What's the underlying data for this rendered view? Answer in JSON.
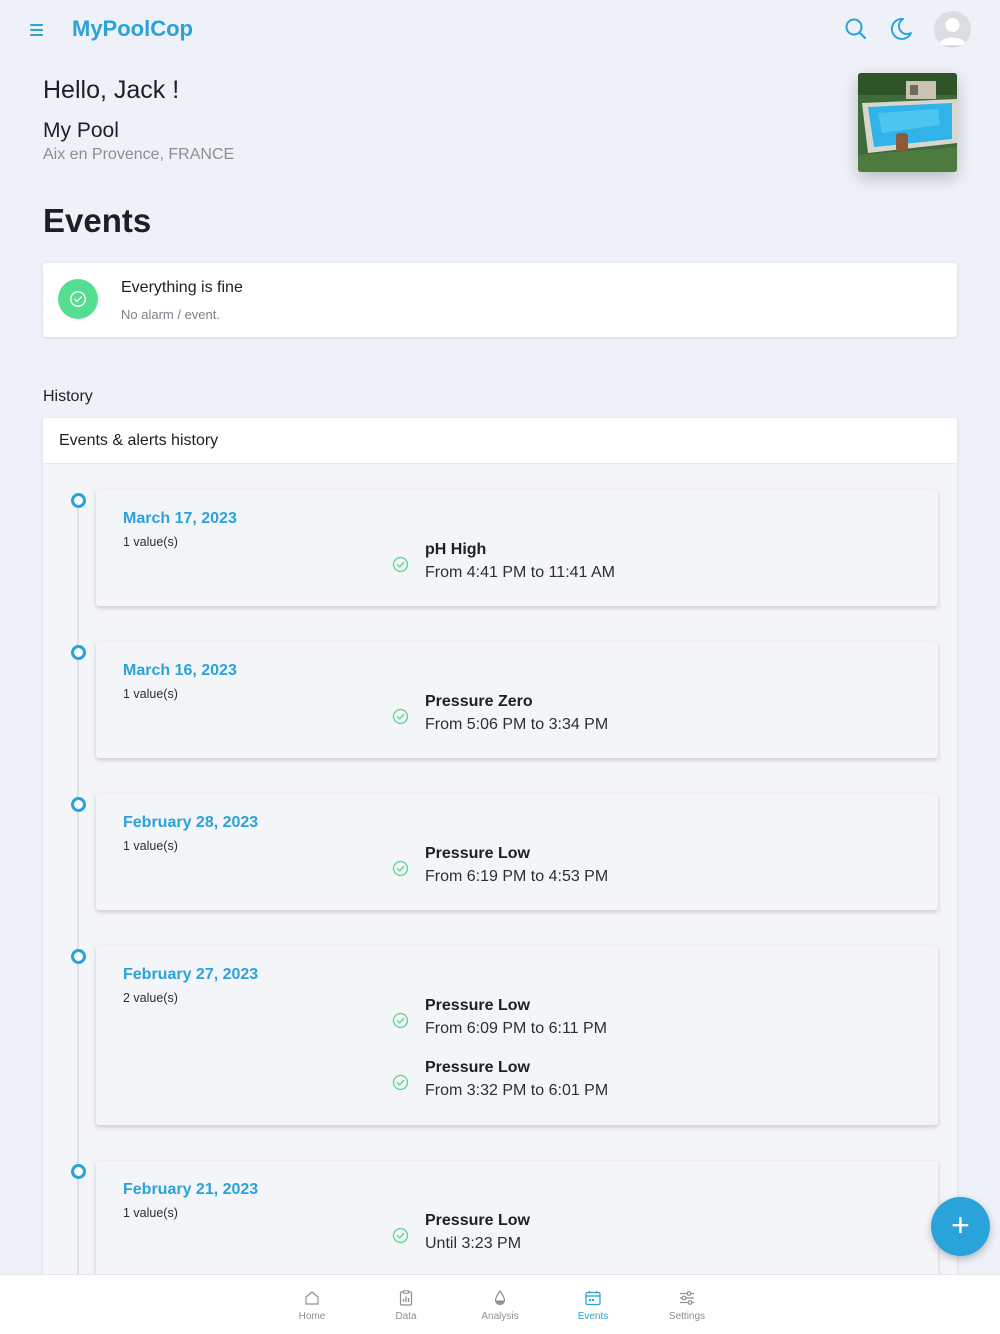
{
  "app": {
    "title": "MyPoolCop"
  },
  "header": {
    "greeting": "Hello, Jack !",
    "pool_name": "My Pool",
    "pool_location": "Aix en Provence, FRANCE"
  },
  "events": {
    "title": "Events",
    "status": {
      "title": "Everything is fine",
      "subtitle": "No alarm / event."
    }
  },
  "history": {
    "label": "History",
    "card_title": "Events & alerts history",
    "days": [
      {
        "date": "March 17, 2023",
        "count": "1 value(s)",
        "events": [
          {
            "name": "pH High",
            "time": "From 4:41 PM to 11:41 AM"
          }
        ]
      },
      {
        "date": "March 16, 2023",
        "count": "1 value(s)",
        "events": [
          {
            "name": "Pressure Zero",
            "time": "From 5:06 PM to 3:34 PM"
          }
        ]
      },
      {
        "date": "February 28, 2023",
        "count": "1 value(s)",
        "events": [
          {
            "name": "Pressure Low",
            "time": "From 6:19 PM to 4:53 PM"
          }
        ]
      },
      {
        "date": "February 27, 2023",
        "count": "2 value(s)",
        "events": [
          {
            "name": "Pressure Low",
            "time": "From 6:09 PM to 6:11 PM"
          },
          {
            "name": "Pressure Low",
            "time": "From 3:32 PM to 6:01 PM"
          }
        ]
      },
      {
        "date": "February 21, 2023",
        "count": "1 value(s)",
        "events": [
          {
            "name": "Pressure Low",
            "time": "Until 3:23 PM"
          }
        ]
      }
    ]
  },
  "fab": {
    "label": "+"
  },
  "nav": {
    "home": "Home",
    "data": "Data",
    "analysis": "Analysis",
    "events": "Events",
    "settings": "Settings"
  },
  "colors": {
    "accent": "#2aa2da",
    "success": "#55dd92",
    "background": "#eef1f8"
  },
  "icons": {
    "menu": "hamburger-menu-icon",
    "search": "search-icon",
    "theme": "moon-icon",
    "status": "check-circle-icon",
    "nav": [
      "home-icon",
      "clipboard-chart-icon",
      "water-drop-icon",
      "calendar-icon",
      "sliders-icon"
    ]
  }
}
